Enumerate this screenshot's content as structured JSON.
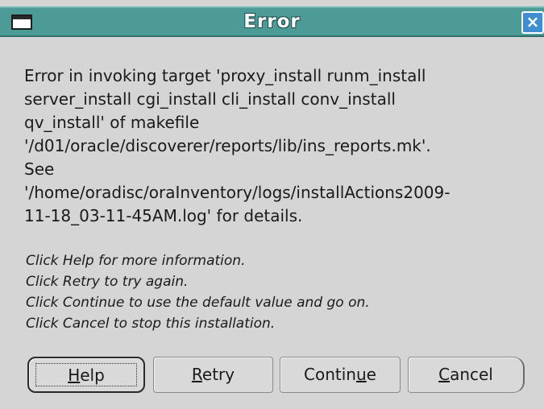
{
  "window": {
    "title": "Error",
    "close_symbol": "×",
    "icon": "window-menu-icon"
  },
  "message": {
    "lines": [
      "Error in invoking target 'proxy_install runm_install",
      "server_install cgi_install cli_install conv_install",
      "qv_install' of makefile",
      "'/d01/oracle/discoverer/reports/lib/ins_reports.mk'.",
      "See",
      "'/home/oradisc/oraInventory/logs/installActions2009-",
      "11-18_03-11-45AM.log' for details."
    ]
  },
  "hints": {
    "lines": [
      "Click Help for more information.",
      "Click Retry to try again.",
      "Click Continue to use the default value and go on.",
      "Click Cancel to stop this installation."
    ]
  },
  "buttons": {
    "help": {
      "mnemonic": "H",
      "rest": "elp"
    },
    "retry": {
      "mnemonic": "R",
      "rest": "etry"
    },
    "continue": {
      "pre": "Contin",
      "mnemonic": "u",
      "rest": "e"
    },
    "cancel": {
      "mnemonic": "C",
      "rest": "ancel"
    }
  },
  "colors": {
    "titlebar": "#4d9b96",
    "background": "#d5d5d5",
    "close_button": "#3f8fd0"
  }
}
